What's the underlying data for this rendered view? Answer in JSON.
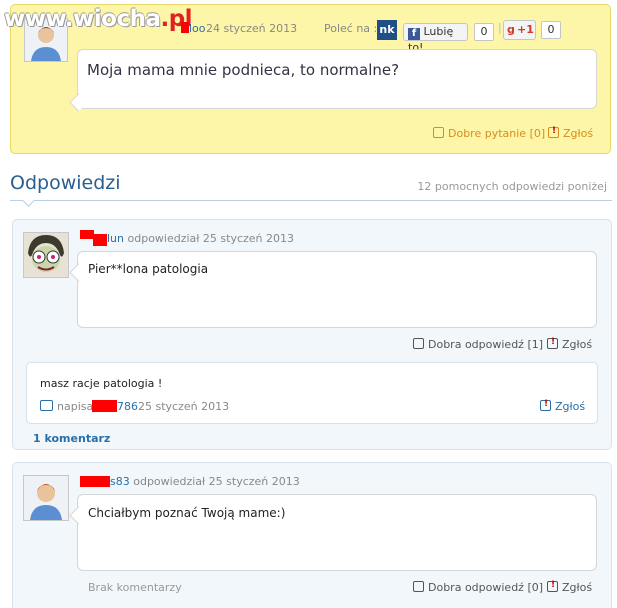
{
  "site": {
    "logo_main": "www.wiocha",
    "logo_tld": ".pl"
  },
  "question": {
    "author_suffix": "loo",
    "date": "24 styczeń 2013",
    "share_label": "Poleć na :",
    "nk_label": "nk",
    "fb_like_label": "Lubię to!",
    "fb_count": "0",
    "gplus_label": "+1",
    "gplus_count": "0",
    "text": "Moja mama mnie podnieca, to normalne?",
    "good_question": "Dobre pytanie [0]",
    "report": "Zgłoś"
  },
  "answers_header": {
    "title": "Odpowiedzi",
    "count_text": "12 pomocnych odpowiedzi poniżej"
  },
  "answers": [
    {
      "author_suffix": "lun",
      "answered_text": "odpowiedział 25 styczeń 2013",
      "text": "Pier**lona patologia",
      "good_answer": "Dobra odpowiedź [1]",
      "report": "Zgłoś",
      "comment": {
        "text": "masz racje patologia !",
        "written_by": "napisał",
        "author_suffix": "786",
        "date": "25 styczeń 2013",
        "report": "Zgłoś"
      },
      "comments_count": "1 komentarz"
    },
    {
      "author_suffix": "s83",
      "answered_text": "odpowiedział 25 styczeń 2013",
      "text": "Chciałbym poznać Twoją mame:)",
      "no_comments": "Brak komentarzy",
      "good_answer": "Dobra odpowiedź [0]",
      "report": "Zgłoś"
    }
  ]
}
